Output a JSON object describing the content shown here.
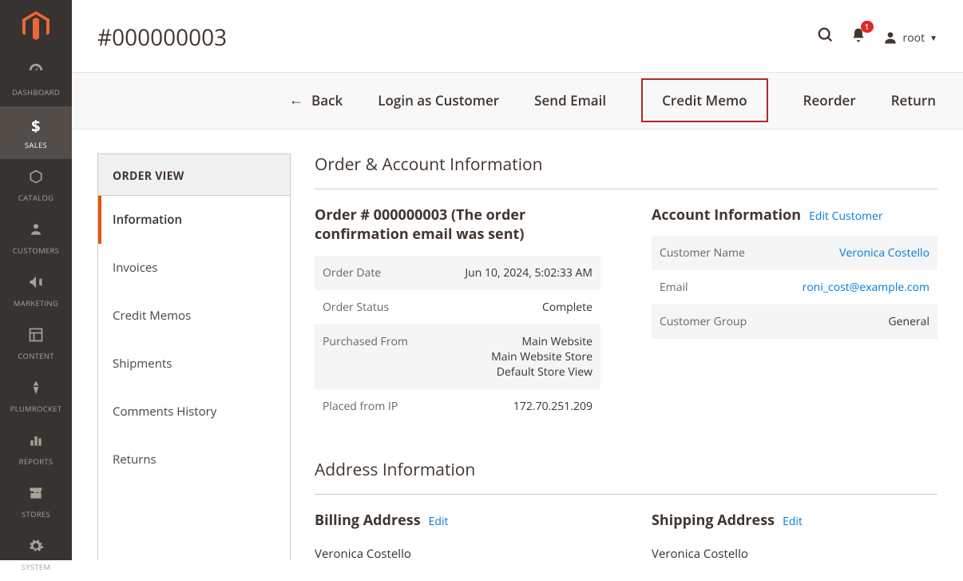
{
  "colors": {
    "accent": "#eb5202",
    "danger": "#e22626",
    "link": "#007bdb"
  },
  "page": {
    "title": "#000000003"
  },
  "header": {
    "notification_count": "1",
    "user_name": "root"
  },
  "sidebar": {
    "items": [
      {
        "icon": "dashboard",
        "label": "DASHBOARD"
      },
      {
        "icon": "sales",
        "label": "SALES"
      },
      {
        "icon": "catalog",
        "label": "CATALOG"
      },
      {
        "icon": "customers",
        "label": "CUSTOMERS"
      },
      {
        "icon": "marketing",
        "label": "MARKETING"
      },
      {
        "icon": "content",
        "label": "CONTENT"
      },
      {
        "icon": "plumrocket",
        "label": "PLUMROCKET"
      },
      {
        "icon": "reports",
        "label": "REPORTS"
      },
      {
        "icon": "stores",
        "label": "STORES"
      },
      {
        "icon": "system",
        "label": "SYSTEM"
      }
    ]
  },
  "actions": {
    "back": "Back",
    "login_as_customer": "Login as Customer",
    "send_email": "Send Email",
    "credit_memo": "Credit Memo",
    "reorder": "Reorder",
    "return": "Return"
  },
  "order_nav": {
    "title": "ORDER VIEW",
    "items": [
      "Information",
      "Invoices",
      "Credit Memos",
      "Shipments",
      "Comments History",
      "Returns"
    ]
  },
  "order_account": {
    "section_title": "Order & Account Information",
    "order_title": "Order # 000000003 (The order confirmation email was sent)",
    "rows": [
      {
        "k": "Order Date",
        "v": "Jun 10, 2024, 5:02:33 AM"
      },
      {
        "k": "Order Status",
        "v": "Complete"
      },
      {
        "k": "Purchased From",
        "v": "Main Website\nMain Website Store\nDefault Store View"
      },
      {
        "k": "Placed from IP",
        "v": "172.70.251.209"
      }
    ],
    "account_title": "Account Information",
    "edit_customer": "Edit Customer",
    "account_rows": [
      {
        "k": "Customer Name",
        "v": "Veronica Costello",
        "link": true
      },
      {
        "k": "Email",
        "v": "roni_cost@example.com",
        "link": true
      },
      {
        "k": "Customer Group",
        "v": "General"
      }
    ]
  },
  "address": {
    "section_title": "Address Information",
    "billing_title": "Billing Address",
    "shipping_title": "Shipping Address",
    "edit": "Edit",
    "billing_name": "Veronica Costello",
    "shipping_name": "Veronica Costello"
  }
}
